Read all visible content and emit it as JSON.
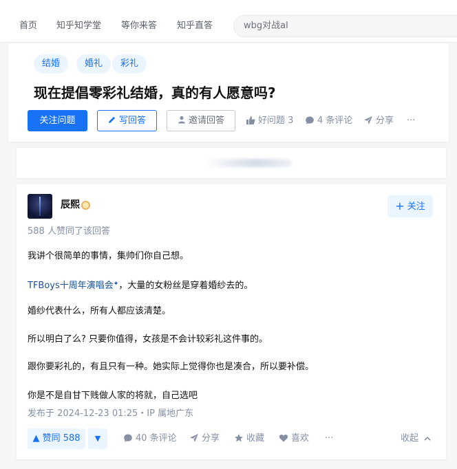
{
  "nav": {
    "items": [
      "首页",
      "知乎知学堂",
      "等你来答",
      "知乎直答"
    ],
    "search_value": "wbg对战al"
  },
  "question": {
    "tags": [
      "结婚",
      "婚礼",
      "彩礼"
    ],
    "title": "现在提倡零彩礼结婚，真的有人愿意吗?",
    "follow_label": "关注问题",
    "write_label": "写回答",
    "invite_label": "邀请回答",
    "good_label": "好问题 3",
    "comments_label": "4 条评论",
    "share_label": "分享",
    "more_label": "···"
  },
  "answer": {
    "author": "辰熙",
    "follow_label": "关注",
    "voters": "588 人赞同了该回答",
    "paragraphs": [
      "我讲个很简单的事情，集帅们你自己想。",
      "，大量的女粉丝是穿着婚纱去的。",
      "婚纱代表什么，所有人都应该清楚。",
      "所以明白了么? 只要你值得，女孩是不会计较彩礼这件事的。",
      "跟你要彩礼的，有且只有一种。她实际上觉得你也是凑合，所以要补偿。",
      "你是不是自甘下贱做人家的将就，自己选吧"
    ],
    "link_text": "TFBoys十周年演唱会",
    "link_mark": "✦",
    "published": "发布于 2024-12-23 01:25・IP 属地广东",
    "vote_up_label": "▲ 赞同 588",
    "vote_down_label": "▼",
    "comments_label": "40 条评论",
    "share_label": "分享",
    "collect_label": "收藏",
    "like_label": "喜欢",
    "more_label": "···",
    "collapse_label": "收起"
  },
  "colors": {
    "accent": "#1772f6",
    "muted": "#8590a6",
    "tag_bg": "#ebf5ff"
  }
}
